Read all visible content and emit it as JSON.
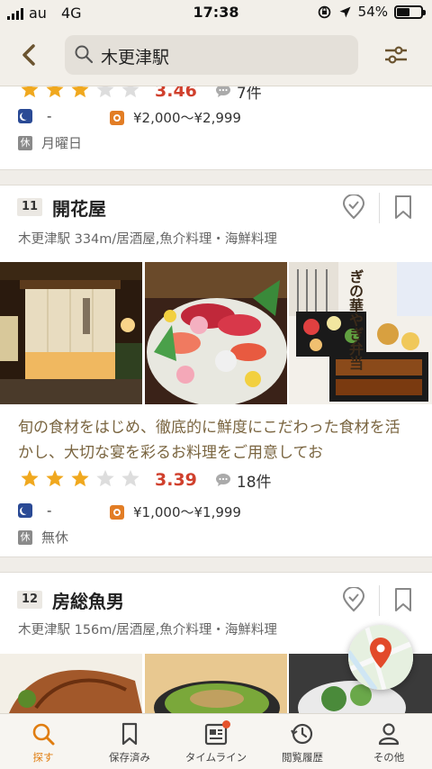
{
  "status_bar": {
    "carrier": "au",
    "network": "4G",
    "time": "17:38",
    "battery": "54%",
    "battery_level": 0.54
  },
  "header": {
    "search_query": "木更津駅"
  },
  "prev_card": {
    "rating": 3.4,
    "score": "3.46",
    "reviews": "7件",
    "dinner_price": "-",
    "lunch_price": "¥2,000～¥2,999",
    "closed_label": "休",
    "holiday": "月曜日"
  },
  "restaurants": [
    {
      "rank": "11",
      "name": "開花屋",
      "meta": "木更津駅 334m/居酒屋,魚介料理・海鮮料理",
      "description": "旬の食材をはじめ、徹底的に鮮度にこだわった食材を活かし、大切な宴を彩るお料理をご用意してお",
      "rating": 3.39,
      "score": "3.39",
      "reviews": "18件",
      "dinner_price": "-",
      "lunch_price": "¥1,000～¥1,999",
      "closed_label": "休",
      "holiday": "無休",
      "photo_text": {
        "bento_title": "ぎの華やぎ弁当"
      }
    },
    {
      "rank": "12",
      "name": "房総魚男",
      "meta": "木更津駅 156m/居酒屋,魚介料理・海鮮料理"
    }
  ],
  "tabs": [
    {
      "label": "探す",
      "icon": "search-icon",
      "active": true
    },
    {
      "label": "保存済み",
      "icon": "bookmark-icon",
      "active": false
    },
    {
      "label": "タイムライン",
      "icon": "timeline-icon",
      "active": false,
      "badge": true
    },
    {
      "label": "閲覧履歴",
      "icon": "history-icon",
      "active": false
    },
    {
      "label": "その他",
      "icon": "user-icon",
      "active": false
    }
  ],
  "colors": {
    "accent": "#e07d10",
    "score": "#d0402d",
    "star": "#f0a81e",
    "header_bg": "#f2efe9"
  }
}
